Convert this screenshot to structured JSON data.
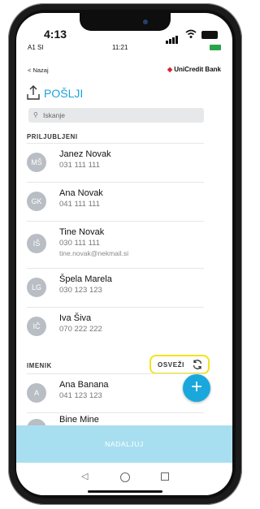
{
  "device": {
    "outer_status": {
      "time": "4:13"
    },
    "inner_status": {
      "carrier": "A1 SI",
      "time": "11:21"
    }
  },
  "header": {
    "back_label": "< Nazaj",
    "brand_name": "UniCredit Bank"
  },
  "page": {
    "title": "POŠLJI",
    "search_placeholder": "Iskanje"
  },
  "favorites": {
    "section_label": "PRILJUBLJENI",
    "items": [
      {
        "initials": "MŠ",
        "name": "Janez Novak",
        "phone": "031 111 111"
      },
      {
        "initials": "GK",
        "name": "Ana Novak",
        "phone": "041 111 111"
      },
      {
        "initials": "IŠ",
        "name": "Tine Novak",
        "phone": "030 111 111",
        "email": "tine.novak@nekmail.si"
      },
      {
        "initials": "LG",
        "name": "Špela Marela",
        "phone": "030 123 123"
      },
      {
        "initials": "IČ",
        "name": "Iva Šiva",
        "phone": "070 222 222"
      }
    ]
  },
  "contacts": {
    "section_label": "IMENIK",
    "refresh_label": "OSVEŽI",
    "items": [
      {
        "initials": "A",
        "name": "Ana Banana",
        "phone": "041 123 123"
      },
      {
        "initials": "",
        "name": "Bine Mine",
        "phone": ""
      }
    ]
  },
  "actions": {
    "fab_label": "+",
    "continue_label": "NADALJUJ"
  },
  "colors": {
    "accent": "#1aa3d7",
    "continue_bg": "#a8dff0",
    "highlight": "#f2e31b",
    "brand_red": "#d8232a"
  }
}
